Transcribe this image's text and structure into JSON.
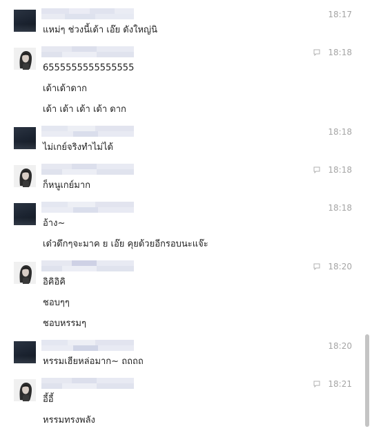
{
  "messages": [
    {
      "avatar": "dark-avatar",
      "time": "18:17",
      "has_reply_icon": false,
      "lines": [
        "แหม่ๆ ช่วงนี้เด้า เอ๊ย ดังใหญ่นิ"
      ]
    },
    {
      "avatar": "girl-avatar",
      "time": "18:18",
      "has_reply_icon": true,
      "lines": [
        "6555555555555555",
        "เด้าเด้าดาก",
        "เด้า เด้า เด้า เด้า ดาก"
      ]
    },
    {
      "avatar": "dark-avatar",
      "time": "18:18",
      "has_reply_icon": false,
      "lines": [
        "ไม่เกย์จริงทำไม่ได้"
      ]
    },
    {
      "avatar": "girl-avatar",
      "time": "18:18",
      "has_reply_icon": true,
      "lines": [
        "ก็หนูเกย์มาก"
      ]
    },
    {
      "avatar": "dark-avatar",
      "time": "18:18",
      "has_reply_icon": false,
      "lines": [
        "อ้าง~",
        "เด๋วดึกๆจะมาค ย เอ๊ย คุยด้วยอีกรอบนะแจ๊ะ"
      ]
    },
    {
      "avatar": "girl-avatar",
      "time": "18:20",
      "has_reply_icon": true,
      "lines": [
        "อิคิอิคิ",
        "ชอบๆๆ",
        "ชอบหรรมๆ"
      ]
    },
    {
      "avatar": "dark-avatar",
      "time": "18:20",
      "has_reply_icon": false,
      "lines": [
        "หรรมเฮียหล่อมาก~ ถถถถ"
      ]
    },
    {
      "avatar": "girl-avatar",
      "time": "18:21",
      "has_reply_icon": true,
      "lines": [
        "อี้อี้",
        "หรรมทรงพลัง"
      ]
    }
  ]
}
